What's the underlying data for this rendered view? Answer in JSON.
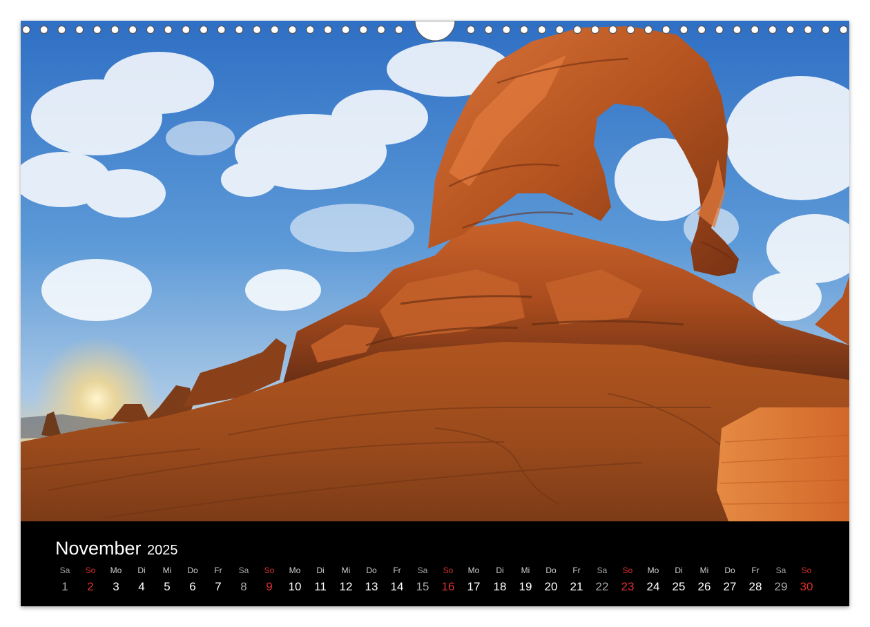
{
  "calendar": {
    "month": "November",
    "year": "2025",
    "weekday_colors": {
      "sat": "#a9a9a9",
      "sun": "#e03030",
      "weekday": "#ffffff"
    },
    "days": [
      {
        "dow": "Sa",
        "num": "1",
        "type": "sat"
      },
      {
        "dow": "So",
        "num": "2",
        "type": "sun"
      },
      {
        "dow": "Mo",
        "num": "3",
        "type": "wd"
      },
      {
        "dow": "Di",
        "num": "4",
        "type": "wd"
      },
      {
        "dow": "Mi",
        "num": "5",
        "type": "wd"
      },
      {
        "dow": "Do",
        "num": "6",
        "type": "wd"
      },
      {
        "dow": "Fr",
        "num": "7",
        "type": "wd"
      },
      {
        "dow": "Sa",
        "num": "8",
        "type": "sat"
      },
      {
        "dow": "So",
        "num": "9",
        "type": "sun"
      },
      {
        "dow": "Mo",
        "num": "10",
        "type": "wd"
      },
      {
        "dow": "Di",
        "num": "11",
        "type": "wd"
      },
      {
        "dow": "Mi",
        "num": "12",
        "type": "wd"
      },
      {
        "dow": "Do",
        "num": "13",
        "type": "wd"
      },
      {
        "dow": "Fr",
        "num": "14",
        "type": "wd"
      },
      {
        "dow": "Sa",
        "num": "15",
        "type": "sat"
      },
      {
        "dow": "So",
        "num": "16",
        "type": "sun"
      },
      {
        "dow": "Mo",
        "num": "17",
        "type": "wd"
      },
      {
        "dow": "Di",
        "num": "18",
        "type": "wd"
      },
      {
        "dow": "Mi",
        "num": "19",
        "type": "wd"
      },
      {
        "dow": "Do",
        "num": "20",
        "type": "wd"
      },
      {
        "dow": "Fr",
        "num": "21",
        "type": "wd"
      },
      {
        "dow": "Sa",
        "num": "22",
        "type": "sat"
      },
      {
        "dow": "So",
        "num": "23",
        "type": "sun"
      },
      {
        "dow": "Mo",
        "num": "24",
        "type": "wd"
      },
      {
        "dow": "Di",
        "num": "25",
        "type": "wd"
      },
      {
        "dow": "Mi",
        "num": "26",
        "type": "wd"
      },
      {
        "dow": "Do",
        "num": "27",
        "type": "wd"
      },
      {
        "dow": "Fr",
        "num": "28",
        "type": "wd"
      },
      {
        "dow": "Sa",
        "num": "29",
        "type": "sat"
      },
      {
        "dow": "So",
        "num": "30",
        "type": "sun"
      }
    ]
  },
  "photo": {
    "icon": "sandstone-arch-landscape",
    "sky_color_top": "#2f77c8",
    "sky_color_horizon": "#f3cf86",
    "rock_color": "#b5521d"
  }
}
